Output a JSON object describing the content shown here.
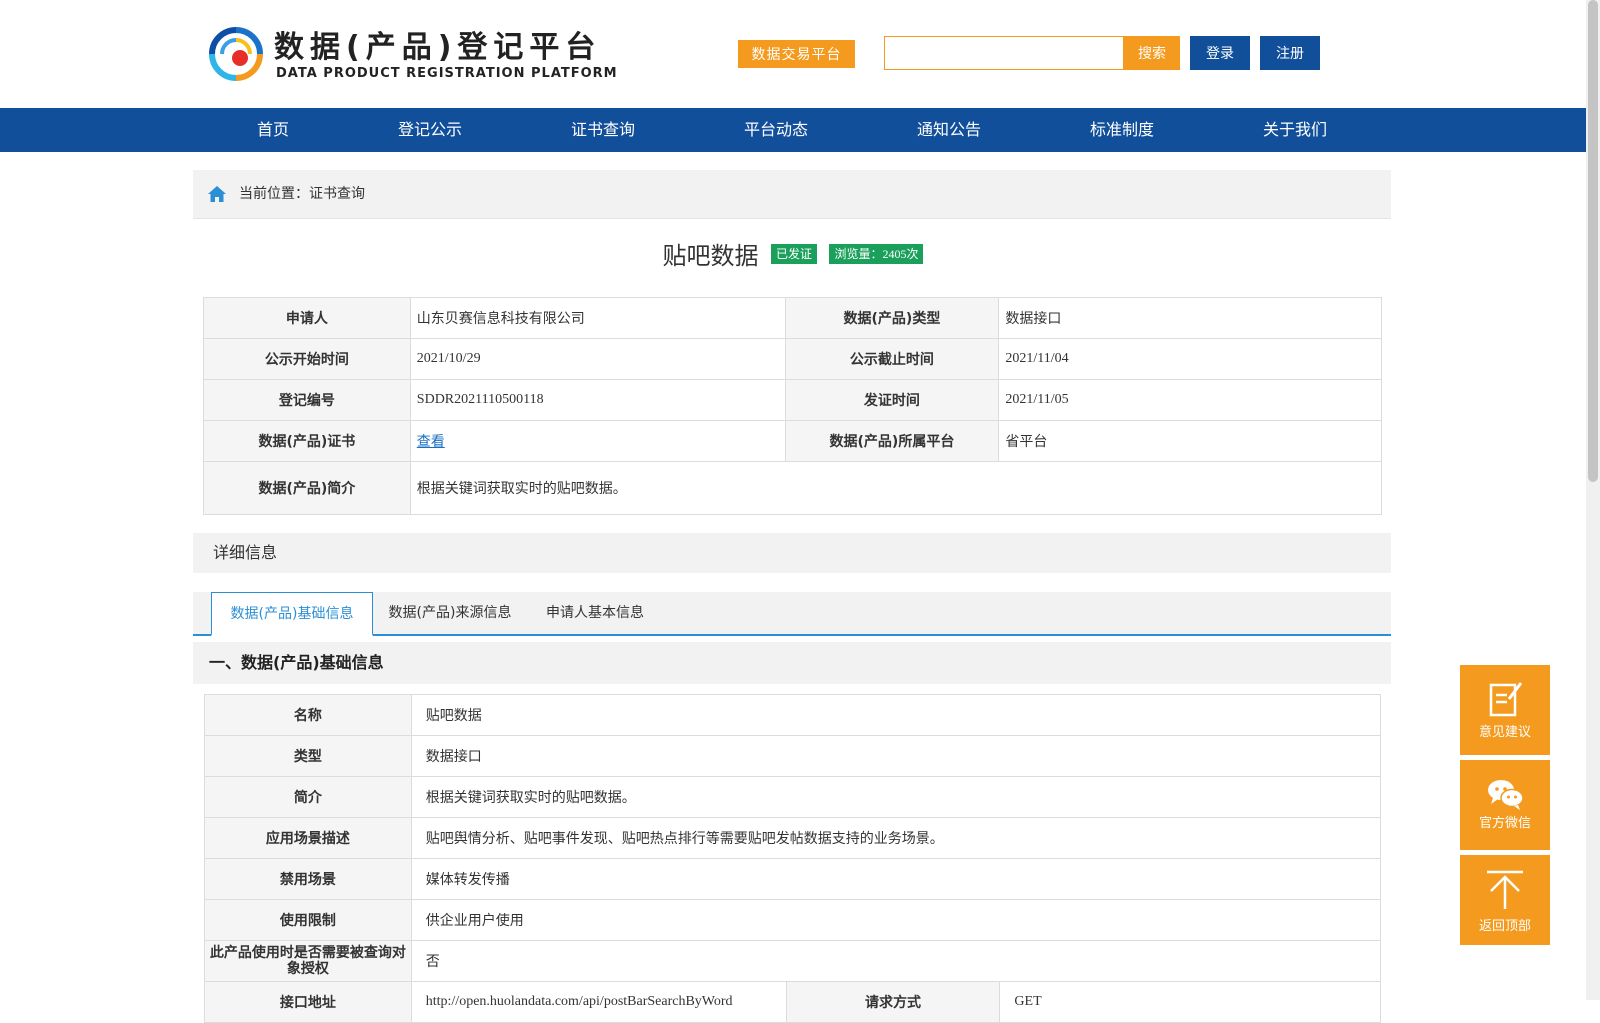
{
  "header": {
    "logo_title": "数据(产品)登记平台",
    "logo_subtitle": "DATA PRODUCT REGISTRATION PLATFORM",
    "trade_button": "数据交易平台",
    "search_placeholder": "",
    "search_button": "搜索",
    "login_button": "登录",
    "register_button": "注册"
  },
  "nav": {
    "items": [
      "首页",
      "登记公示",
      "证书查询",
      "平台动态",
      "通知公告",
      "标准制度",
      "关于我们"
    ]
  },
  "breadcrumb": {
    "text": "当前位置：证书查询"
  },
  "product": {
    "title": "贴吧数据",
    "status_badge": "已发证",
    "views_badge": "浏览量：2405次"
  },
  "summary": {
    "applicant_label": "申请人",
    "applicant": "山东贝赛信息科技有限公司",
    "type_label": "数据(产品)类型",
    "type": "数据接口",
    "start_label": "公示开始时间",
    "start": "2021/10/29",
    "end_label": "公示截止时间",
    "end": "2021/11/04",
    "regno_label": "登记编号",
    "regno": "SDDR2021110500118",
    "issue_label": "发证时间",
    "issue": "2021/11/05",
    "cert_label": "数据(产品)证书",
    "cert_link": "查看",
    "platform_label": "数据(产品)所属平台",
    "platform": "省平台",
    "intro_label": "数据(产品)简介",
    "intro": "根据关键词获取实时的贴吧数据。"
  },
  "detail": {
    "heading": "详细信息",
    "tabs": [
      "数据(产品)基础信息",
      "数据(产品)来源信息",
      "申请人基本信息"
    ],
    "section_title": "一、数据(产品)基础信息",
    "rows": [
      {
        "k": "名称",
        "v": "贴吧数据"
      },
      {
        "k": "类型",
        "v": "数据接口"
      },
      {
        "k": "简介",
        "v": "根据关键词获取实时的贴吧数据。"
      },
      {
        "k": "应用场景描述",
        "v": "贴吧舆情分析、贴吧事件发现、贴吧热点排行等需要贴吧发帖数据支持的业务场景。"
      },
      {
        "k": "禁用场景",
        "v": "媒体转发传播"
      },
      {
        "k": "使用限制",
        "v": "供企业用户使用"
      },
      {
        "k": "此产品使用时是否需要被查询对象授权",
        "v": "否"
      }
    ],
    "api_label": "接口地址",
    "api": "http://open.huolandata.com/api/postBarSearchByWord",
    "method_label": "请求方式",
    "method": "GET"
  },
  "float": {
    "feedback": "意见建议",
    "wechat": "官方微信",
    "top": "返回顶部"
  },
  "colors": {
    "primary_blue": "#124f9b",
    "accent_orange": "#f39a1f",
    "badge_green": "#1aa05a",
    "tab_blue": "#2b8fd6"
  }
}
